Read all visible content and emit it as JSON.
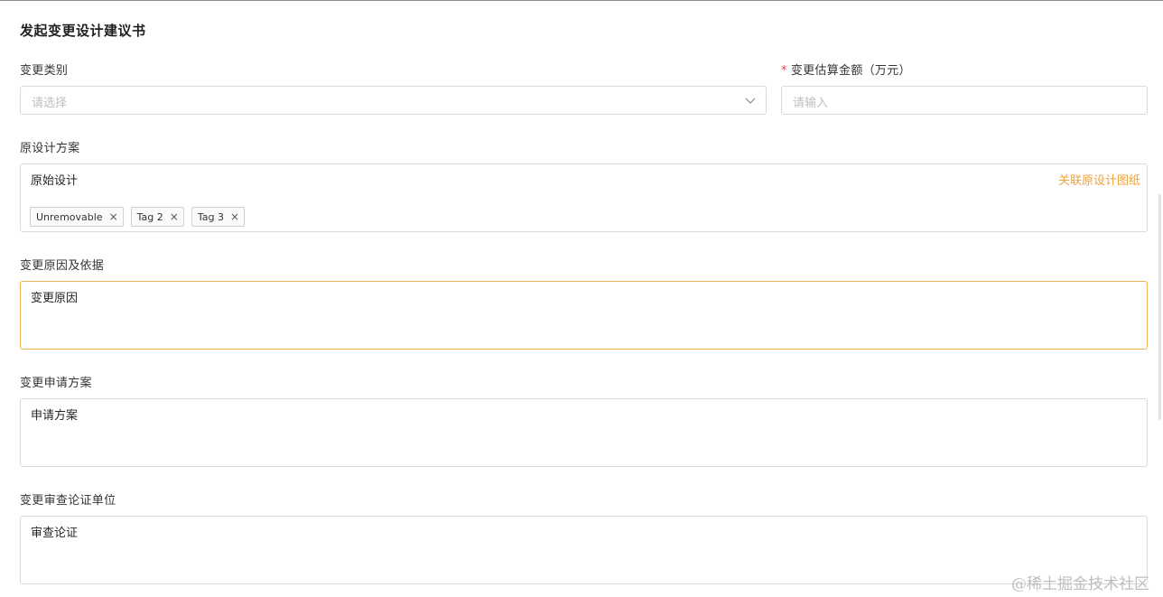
{
  "form": {
    "title": "发起变更设计建议书",
    "change_type": {
      "label": "变更类别",
      "placeholder": "请选择"
    },
    "estimated_amount": {
      "required_mark": "*",
      "label": "变更估算金额（万元）",
      "placeholder": "请输入"
    },
    "original_design": {
      "label": "原设计方案",
      "value": "原始设计",
      "link_label": "关联原设计图纸",
      "tags": [
        {
          "label": "Unremovable",
          "close": "×"
        },
        {
          "label": "Tag 2",
          "close": "×"
        },
        {
          "label": "Tag 3",
          "close": "×"
        }
      ]
    },
    "change_reason": {
      "label": "变更原因及依据",
      "value": "变更原因"
    },
    "change_plan": {
      "label": "变更申请方案",
      "value": "申请方案"
    },
    "review_unit": {
      "label": "变更审查论证单位",
      "value": "审查论证"
    }
  },
  "colors": {
    "accent": "#f0a23c",
    "focus_border": "#f0b253",
    "required": "#e5484d",
    "border": "#d9d9d9"
  },
  "watermark": "@稀土掘金技术社区"
}
